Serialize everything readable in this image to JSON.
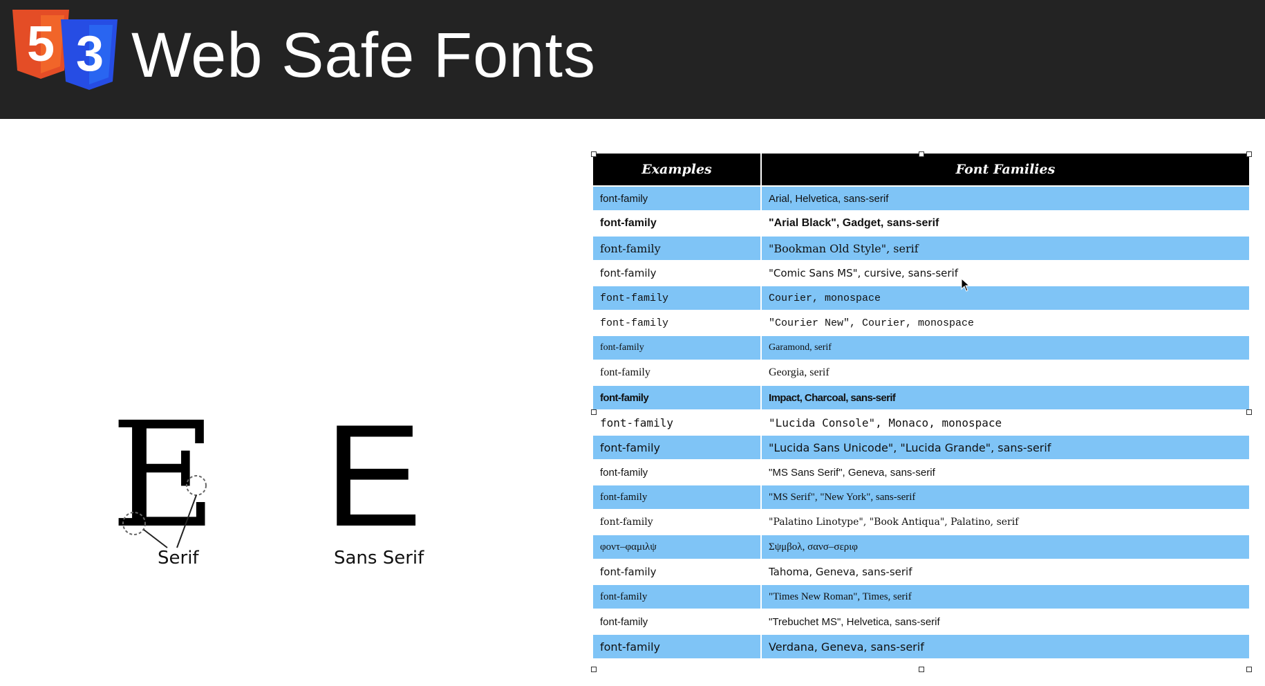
{
  "header": {
    "title": "Web Safe Fonts",
    "logo_html5_digit": "5",
    "logo_css3_digit": "3",
    "colors": {
      "background": "#232323",
      "html5_orange": "#e44d26",
      "css3_blue": "#264de4"
    }
  },
  "illustration": {
    "serif_letter": "E",
    "sans_letter": "E",
    "serif_label": "Serif",
    "sans_label": "Sans Serif"
  },
  "table": {
    "headers": [
      "Examples",
      "Font Families"
    ],
    "colors": {
      "header_bg": "#000000",
      "row_blue": "#7fc4f6",
      "row_white": "#ffffff"
    },
    "rows": [
      {
        "example": "font-family",
        "families": "Arial, Helvetica, sans-serif"
      },
      {
        "example": "font-family",
        "families": "\"Arial Black\", Gadget, sans-serif"
      },
      {
        "example": "font-family",
        "families": "\"Bookman Old Style\", serif"
      },
      {
        "example": "font-family",
        "families": "\"Comic Sans MS\", cursive, sans-serif"
      },
      {
        "example": "font-family",
        "families": "Courier, monospace"
      },
      {
        "example": "font-family",
        "families": "\"Courier New\", Courier, monospace"
      },
      {
        "example": "font-family",
        "families": "Garamond, serif"
      },
      {
        "example": "font-family",
        "families": "Georgia, serif"
      },
      {
        "example": "font-family",
        "families": "Impact, Charcoal, sans-serif"
      },
      {
        "example": "font-family",
        "families": "\"Lucida Console\", Monaco, monospace"
      },
      {
        "example": "font-family",
        "families": "\"Lucida Sans Unicode\", \"Lucida Grande\", sans-serif"
      },
      {
        "example": "font-family",
        "families": "\"MS Sans Serif\", Geneva, sans-serif"
      },
      {
        "example": "font-family",
        "families": "\"MS Serif\", \"New York\", sans-serif"
      },
      {
        "example": "font-family",
        "families": "\"Palatino Linotype\", \"Book Antiqua\", Palatino, serif"
      },
      {
        "example": "φοντ–φαμιλψ",
        "families": "Σψμβολ, σανσ–σεριφ"
      },
      {
        "example": "font-family",
        "families": "Tahoma, Geneva, sans-serif"
      },
      {
        "example": "font-family",
        "families": "\"Times New Roman\", Times, serif"
      },
      {
        "example": "font-family",
        "families": "\"Trebuchet MS\", Helvetica, sans-serif"
      },
      {
        "example": "font-family",
        "families": "Verdana, Geneva, sans-serif"
      }
    ]
  }
}
